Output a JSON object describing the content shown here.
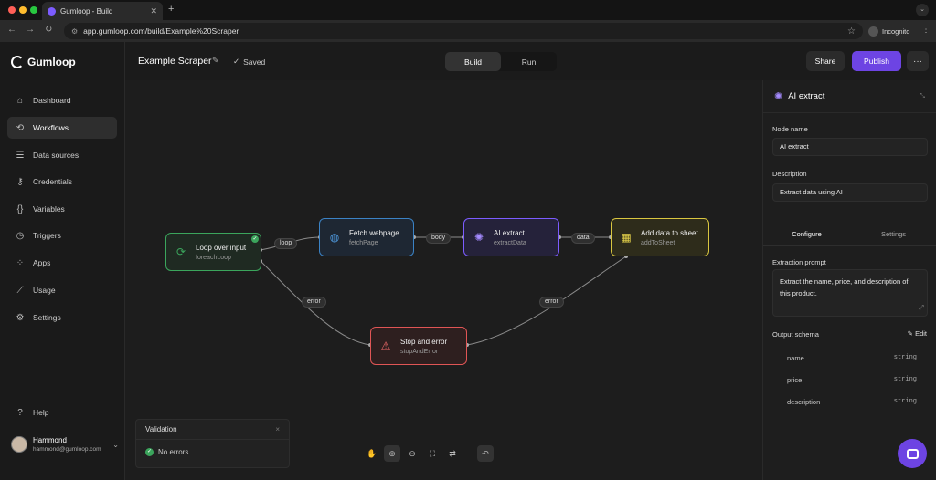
{
  "browser": {
    "tab_title": "Gumloop - Build",
    "url": "app.gumloop.com/build/Example%20Scraper",
    "incognito_label": "Incognito"
  },
  "sidebar": {
    "brand": "Gumloop",
    "items": [
      {
        "label": "Dashboard",
        "icon": "home-icon"
      },
      {
        "label": "Workflows",
        "icon": "workflow-icon",
        "active": true
      },
      {
        "label": "Data sources",
        "icon": "database-icon"
      },
      {
        "label": "Credentials",
        "icon": "key-icon"
      },
      {
        "label": "Variables",
        "icon": "variable-icon"
      },
      {
        "label": "Triggers",
        "icon": "trigger-icon"
      },
      {
        "label": "Apps",
        "icon": "apps-icon"
      },
      {
        "label": "Usage",
        "icon": "chart-icon"
      },
      {
        "label": "Settings",
        "icon": "gear-icon"
      }
    ],
    "help": "Help",
    "user": {
      "name": "Hammond",
      "email": "hammond@gumloop.com"
    }
  },
  "header": {
    "workflow_title": "Example Scraper",
    "saved_label": "Saved",
    "modes": [
      "Build",
      "Run"
    ],
    "active_mode": "Build",
    "share_label": "Share",
    "publish_label": "Publish",
    "more_label": "···"
  },
  "canvas": {
    "nodes": {
      "loop": {
        "title": "Loop over input",
        "subtitle": "foreachLoop"
      },
      "fetch": {
        "title": "Fetch webpage",
        "subtitle": "fetchPage"
      },
      "ai": {
        "title": "AI extract",
        "subtitle": "extractData"
      },
      "sheet": {
        "title": "Add data to sheet",
        "subtitle": "addToSheet"
      },
      "stop": {
        "title": "Stop and error",
        "subtitle": "stopAndError"
      }
    },
    "edge_labels": {
      "loop": "loop",
      "body": "body",
      "data": "data",
      "error_left": "error",
      "error_right": "error"
    },
    "colors": {
      "loop": "#3ba55c",
      "fetch": "#3b82c4",
      "ai": "#7c5cff",
      "sheet": "#d9c640",
      "stop": "#e05555"
    },
    "validation": {
      "title": "Validation",
      "status": "No errors"
    }
  },
  "panel": {
    "title": "AI extract",
    "node_name_label": "Node name",
    "node_name_value": "AI extract",
    "description_label": "Description",
    "description_value": "Extract data using AI",
    "tabs": [
      "Configure",
      "Settings"
    ],
    "active_tab": "Configure",
    "prompt_label": "Extraction prompt",
    "prompt_value": "Extract the name, price, and description of this product.",
    "schema_label": "Output schema",
    "schema_edit": "Edit",
    "schema": [
      {
        "name": "name",
        "type": "string"
      },
      {
        "name": "price",
        "type": "string"
      },
      {
        "name": "description",
        "type": "string"
      }
    ]
  }
}
